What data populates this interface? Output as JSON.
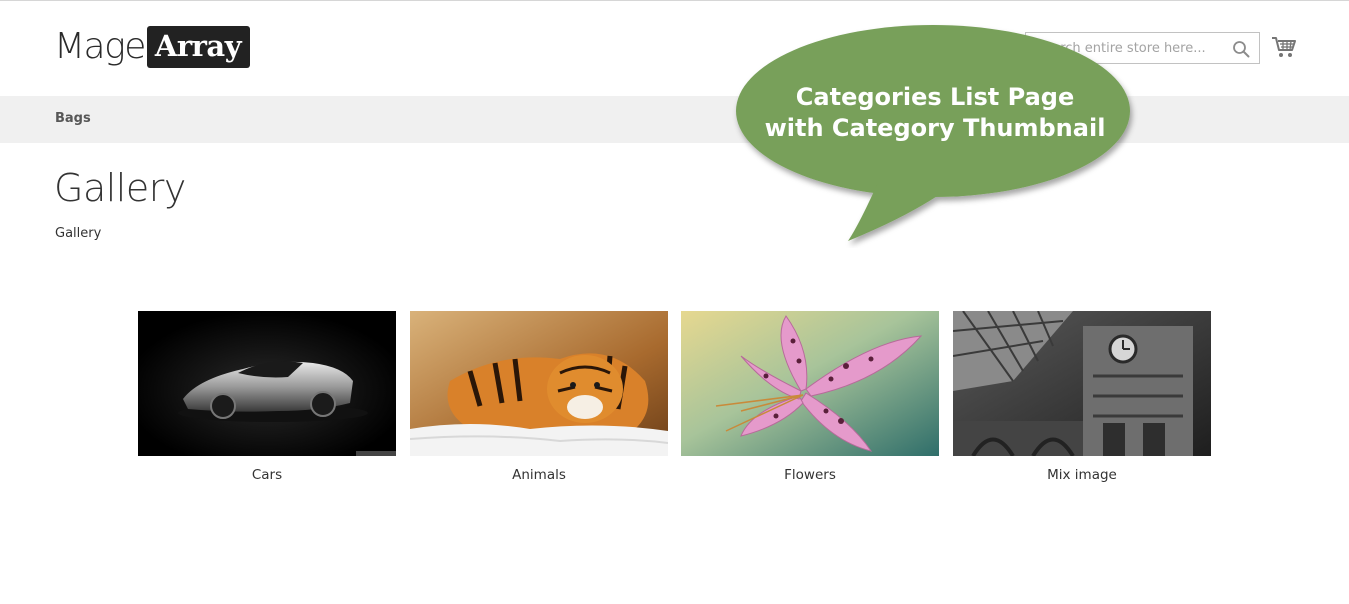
{
  "header": {
    "logo": {
      "part1": "Mage",
      "part2": "Array"
    },
    "search": {
      "placeholder": "Search entire store here...",
      "icon": "search-icon"
    },
    "cart_icon": "cart-icon"
  },
  "nav": {
    "items": [
      {
        "label": "Bags"
      }
    ]
  },
  "main": {
    "title": "Gallery",
    "description": "Gallery",
    "categories": [
      {
        "label": "Cars",
        "image": "car-photo"
      },
      {
        "label": "Animals",
        "image": "tiger-photo"
      },
      {
        "label": "Flowers",
        "image": "lily-photo"
      },
      {
        "label": "Mix image",
        "image": "clocktower-photo"
      }
    ]
  },
  "callout": {
    "line1": "Categories List Page",
    "line2": "with Category Thumbnail",
    "color": "#78a05a"
  }
}
